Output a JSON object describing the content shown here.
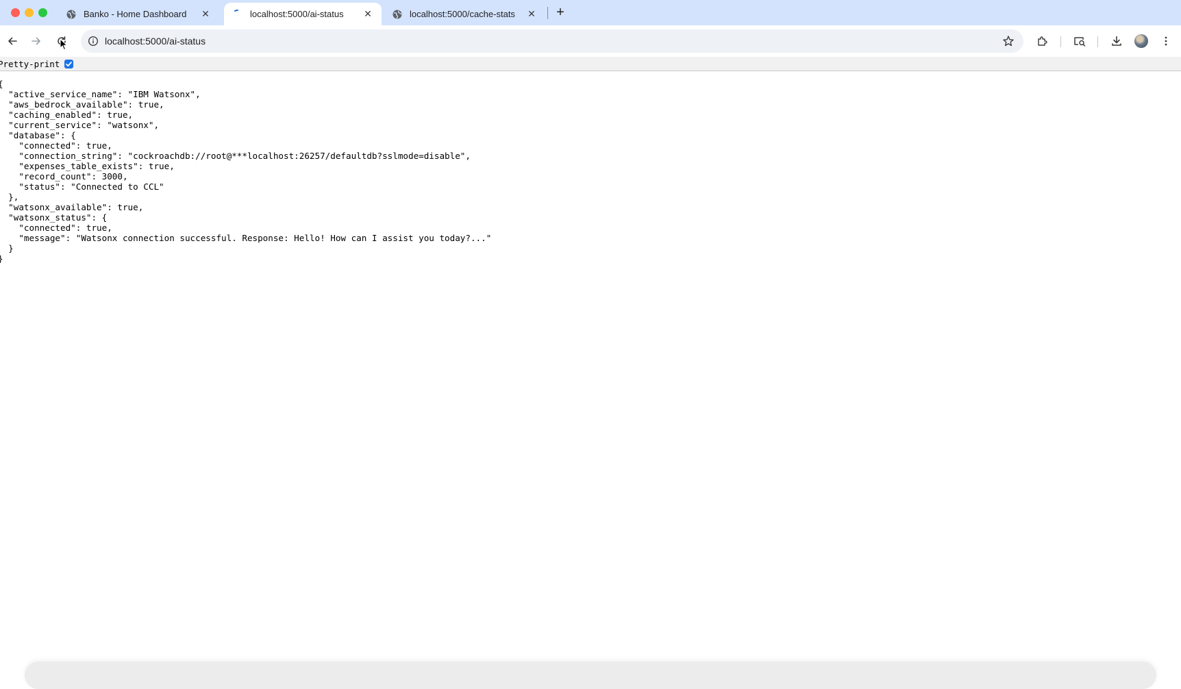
{
  "tabs": [
    {
      "title": "Banko - Home Dashboard",
      "active": false,
      "close_icon": "close-icon"
    },
    {
      "title": "localhost:5000/ai-status",
      "active": true,
      "loading": true,
      "close_icon": "close-icon"
    },
    {
      "title": "localhost:5000/cache-stats",
      "active": false,
      "close_icon": "close-icon"
    }
  ],
  "new_tab": "+",
  "toolbar": {
    "url": "localhost:5000/ai-status",
    "icons": [
      "back-icon",
      "forward-icon",
      "reload-icon",
      "info-icon",
      "star-icon",
      "extensions-icon",
      "cast-search-icon",
      "download-icon",
      "avatar",
      "menu-icon"
    ]
  },
  "pretty_print": {
    "label": "Pretty-print",
    "checked": true
  },
  "json_lines": [
    "{",
    "  \"active_service_name\": \"IBM Watsonx\",",
    "  \"aws_bedrock_available\": true,",
    "  \"caching_enabled\": true,",
    "  \"current_service\": \"watsonx\",",
    "  \"database\": {",
    "    \"connected\": true,",
    "    \"connection_string\": \"cockroachdb://root@***localhost:26257/defaultdb?sslmode=disable\",",
    "    \"expenses_table_exists\": true,",
    "    \"record_count\": 3000,",
    "    \"status\": \"Connected to CCL\"",
    "  },",
    "  \"watsonx_available\": true,",
    "  \"watsonx_status\": {",
    "    \"connected\": true,",
    "    \"message\": \"Watsonx connection successful. Response: Hello! How can I assist you today?...\"",
    "  }",
    "}"
  ],
  "colors": {
    "tabstrip_bg": "#d3e3fd",
    "omnibox_bg": "#eef1f6",
    "checkbox": "#1a73e8"
  }
}
